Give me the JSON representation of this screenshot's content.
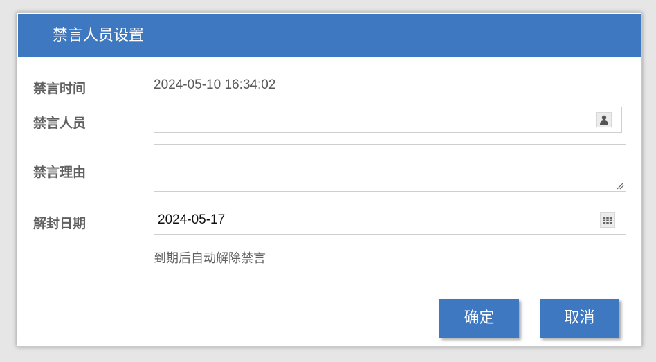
{
  "dialog": {
    "title": "禁言人员设置"
  },
  "form": {
    "mute_time_label": "禁言时间",
    "mute_time_value": "2024-05-10 16:34:02",
    "person_label": "禁言人员",
    "person_value": "",
    "reason_label": "禁言理由",
    "reason_value": "",
    "unban_date_label": "解封日期",
    "unban_date_value": "2024-05-17",
    "hint": "到期后自动解除禁言"
  },
  "buttons": {
    "ok": "确定",
    "cancel": "取消"
  },
  "icons": {
    "person_picker": "user-icon",
    "date_picker": "calendar-icon"
  },
  "colors": {
    "accent": "#3d78c1",
    "label": "#606060"
  }
}
